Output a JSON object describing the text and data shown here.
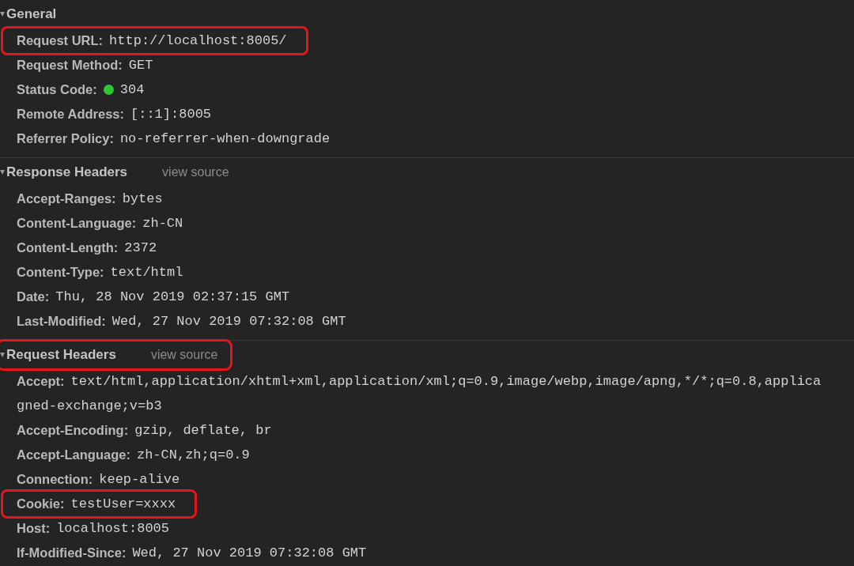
{
  "sections": [
    {
      "title": "General",
      "expanded": true,
      "highlighted": false,
      "rows": [
        {
          "key": "Request URL:",
          "value": "http://localhost:8005/",
          "highlighted": true
        },
        {
          "key": "Request Method:",
          "value": "GET",
          "highlighted": false
        },
        {
          "key": "Status Code:",
          "value": "304",
          "color": "#2fc635",
          "highlighted": false
        },
        {
          "key": "Remote Address:",
          "value": "[::1]:8005",
          "highlighted": false
        },
        {
          "key": "Referrer Policy:",
          "value": "no-referrer-when-downgrade",
          "highlighted": false
        }
      ]
    },
    {
      "title": "Response Headers",
      "view_source": "view source",
      "expanded": true,
      "highlighted": false,
      "rows": [
        {
          "key": "Accept-Ranges:",
          "value": "bytes",
          "highlighted": false
        },
        {
          "key": "Content-Language:",
          "value": "zh-CN",
          "highlighted": false
        },
        {
          "key": "Content-Length:",
          "value": "2372",
          "highlighted": false
        },
        {
          "key": "Content-Type:",
          "value": "text/html",
          "highlighted": false
        },
        {
          "key": "Date:",
          "value": "Thu, 28 Nov 2019 02:37:15 GMT",
          "highlighted": false
        },
        {
          "key": "Last-Modified:",
          "value": "Wed, 27 Nov 2019 07:32:08 GMT",
          "highlighted": false
        }
      ]
    },
    {
      "title": "Request Headers",
      "view_source": "view source",
      "expanded": true,
      "highlighted": true,
      "rows": [
        {
          "key": "Accept:",
          "value": "text/html,application/xhtml+xml,application/xml;q=0.9,image/webp,image/apng,*/*;q=0.8,applica",
          "continuation": "gned-exchange;v=b3",
          "highlighted": false
        },
        {
          "key": "Accept-Encoding:",
          "value": "gzip, deflate, br",
          "highlighted": false
        },
        {
          "key": "Accept-Language:",
          "value": "zh-CN,zh;q=0.9",
          "highlighted": false
        },
        {
          "key": "Connection:",
          "value": "keep-alive",
          "highlighted": false
        },
        {
          "key": "Cookie:",
          "value": "testUser=xxxx",
          "highlighted": true
        },
        {
          "key": "Host:",
          "value": "localhost:8005",
          "highlighted": false
        },
        {
          "key": "If-Modified-Since:",
          "value": "Wed, 27 Nov 2019 07:32:08 GMT",
          "highlighted": false
        }
      ]
    }
  ]
}
